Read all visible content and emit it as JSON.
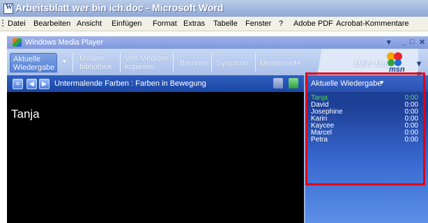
{
  "word": {
    "title": "Arbeitsblatt wer bin ich.doc - Microsoft Word",
    "doc_icon_letter": "W",
    "menu": [
      "Datei",
      "Bearbeiten",
      "Ansicht",
      "Einfügen",
      "Format",
      "Extras",
      "Tabelle",
      "Fenster",
      "?",
      "Adobe PDF",
      "Acrobat-Kommentare"
    ]
  },
  "wmp": {
    "title": "Windows Media Player",
    "controls": {
      "dropdown": "▾",
      "minimize": "_",
      "restore": "□",
      "close": "✕"
    },
    "tabs": [
      {
        "label": "Aktuelle Wiedergabe",
        "active": true
      },
      {
        "label": "Medien- bibliothek"
      },
      {
        "label": "Von Medium kopieren"
      },
      {
        "label": "Brennen"
      },
      {
        "label": "Synchron."
      },
      {
        "label": "Medienseite"
      }
    ],
    "msn_label": "MSN Music",
    "msn_word": "msn",
    "overflow": "▾ »",
    "info_text": "Untermalende Farben : Farben in Bewegung",
    "video_caption": "Tanja",
    "panel_label": "Aktuelle Wiedergabe",
    "panel_caret": "▼",
    "playlist": [
      {
        "name": "Tanja",
        "duration": "0:00"
      },
      {
        "name": "David",
        "duration": "0:00"
      },
      {
        "name": "Josephine",
        "duration": "0:00"
      },
      {
        "name": "Karin",
        "duration": "0:00"
      },
      {
        "name": "Kaycee",
        "duration": "0:00"
      },
      {
        "name": "Marcel",
        "duration": "0:00"
      },
      {
        "name": "Petra",
        "duration": "0:00"
      }
    ]
  },
  "colors": {
    "active_track": "#53d94b",
    "highlight_box": "#e0001a",
    "video_bg": "#000000"
  }
}
